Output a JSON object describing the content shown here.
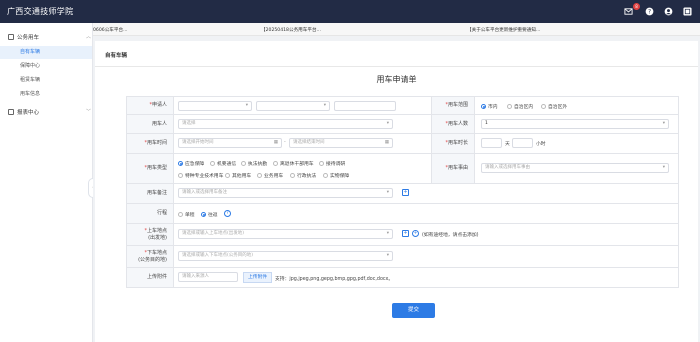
{
  "app": {
    "title": "广西交通技师学院",
    "mail_badge": "8"
  },
  "sidebar": {
    "groups": [
      {
        "label": "公务用车",
        "items": [
          "自有车辆",
          "保障中心",
          "租赁车辆",
          "用车信息"
        ]
      },
      {
        "label": "报表中心"
      }
    ]
  },
  "ticker": {
    "items": [
      "0606公车平台...",
      "【20250418公务用车平台...",
      "【关于公车平台更新维护重要通知..."
    ]
  },
  "page": {
    "title": "自有车辆"
  },
  "form": {
    "title": "用车申请单",
    "applicant_label": "申请人",
    "scope_label": "用车范围",
    "scope_options": [
      "市内",
      "自治区内",
      "自治区外"
    ],
    "user_label": "用车人",
    "user_placeholder": "请选择",
    "count_label": "用车人数",
    "count_value": "1",
    "time_label": "用车时间",
    "start_placeholder": "请选择开始时间",
    "end_placeholder": "请选择结束时间",
    "duration_label": "用车时长",
    "days_unit": "天",
    "hours_unit": "小时",
    "type_label": "用车类型",
    "type_options_row1": [
      "应急保障",
      "机要通信",
      "执法执勤",
      "离退休干部用车",
      "接待调研"
    ],
    "type_options_row2": [
      "特种专业技术用车",
      "其他用车",
      "业务用车",
      "行政执法",
      "实物保障"
    ],
    "reason_label": "用车事由",
    "reason_placeholder": "请输入或选择用车事由",
    "remark_label": "用车备注",
    "remark_placeholder": "请输入或选择用车备注",
    "trip_label": "行程",
    "trip_options": [
      "单程",
      "往返"
    ],
    "pickup_label": "上车地点",
    "pickup_sub": "(出发地)",
    "pickup_placeholder": "请选择或输入上车地点(出发地)",
    "pickup_note": "(如有途经地，请点击添加)",
    "dropoff_label": "下车地点",
    "dropoff_sub": "(公务目的地)",
    "dropoff_placeholder": "请选择或输入下车地点(公务目的地)",
    "attach_label": "上传附件",
    "attach_placeholder": "请输入来源人",
    "upload_button": "上传附件",
    "support_text": "支持：jpg,jpeg,png,gepg,bmp,gpg,pdf,doc,docx。",
    "submit_button": "提交"
  },
  "colors": {
    "topbar": "#222b45",
    "accent": "#2d7be5",
    "required": "#e04040"
  }
}
